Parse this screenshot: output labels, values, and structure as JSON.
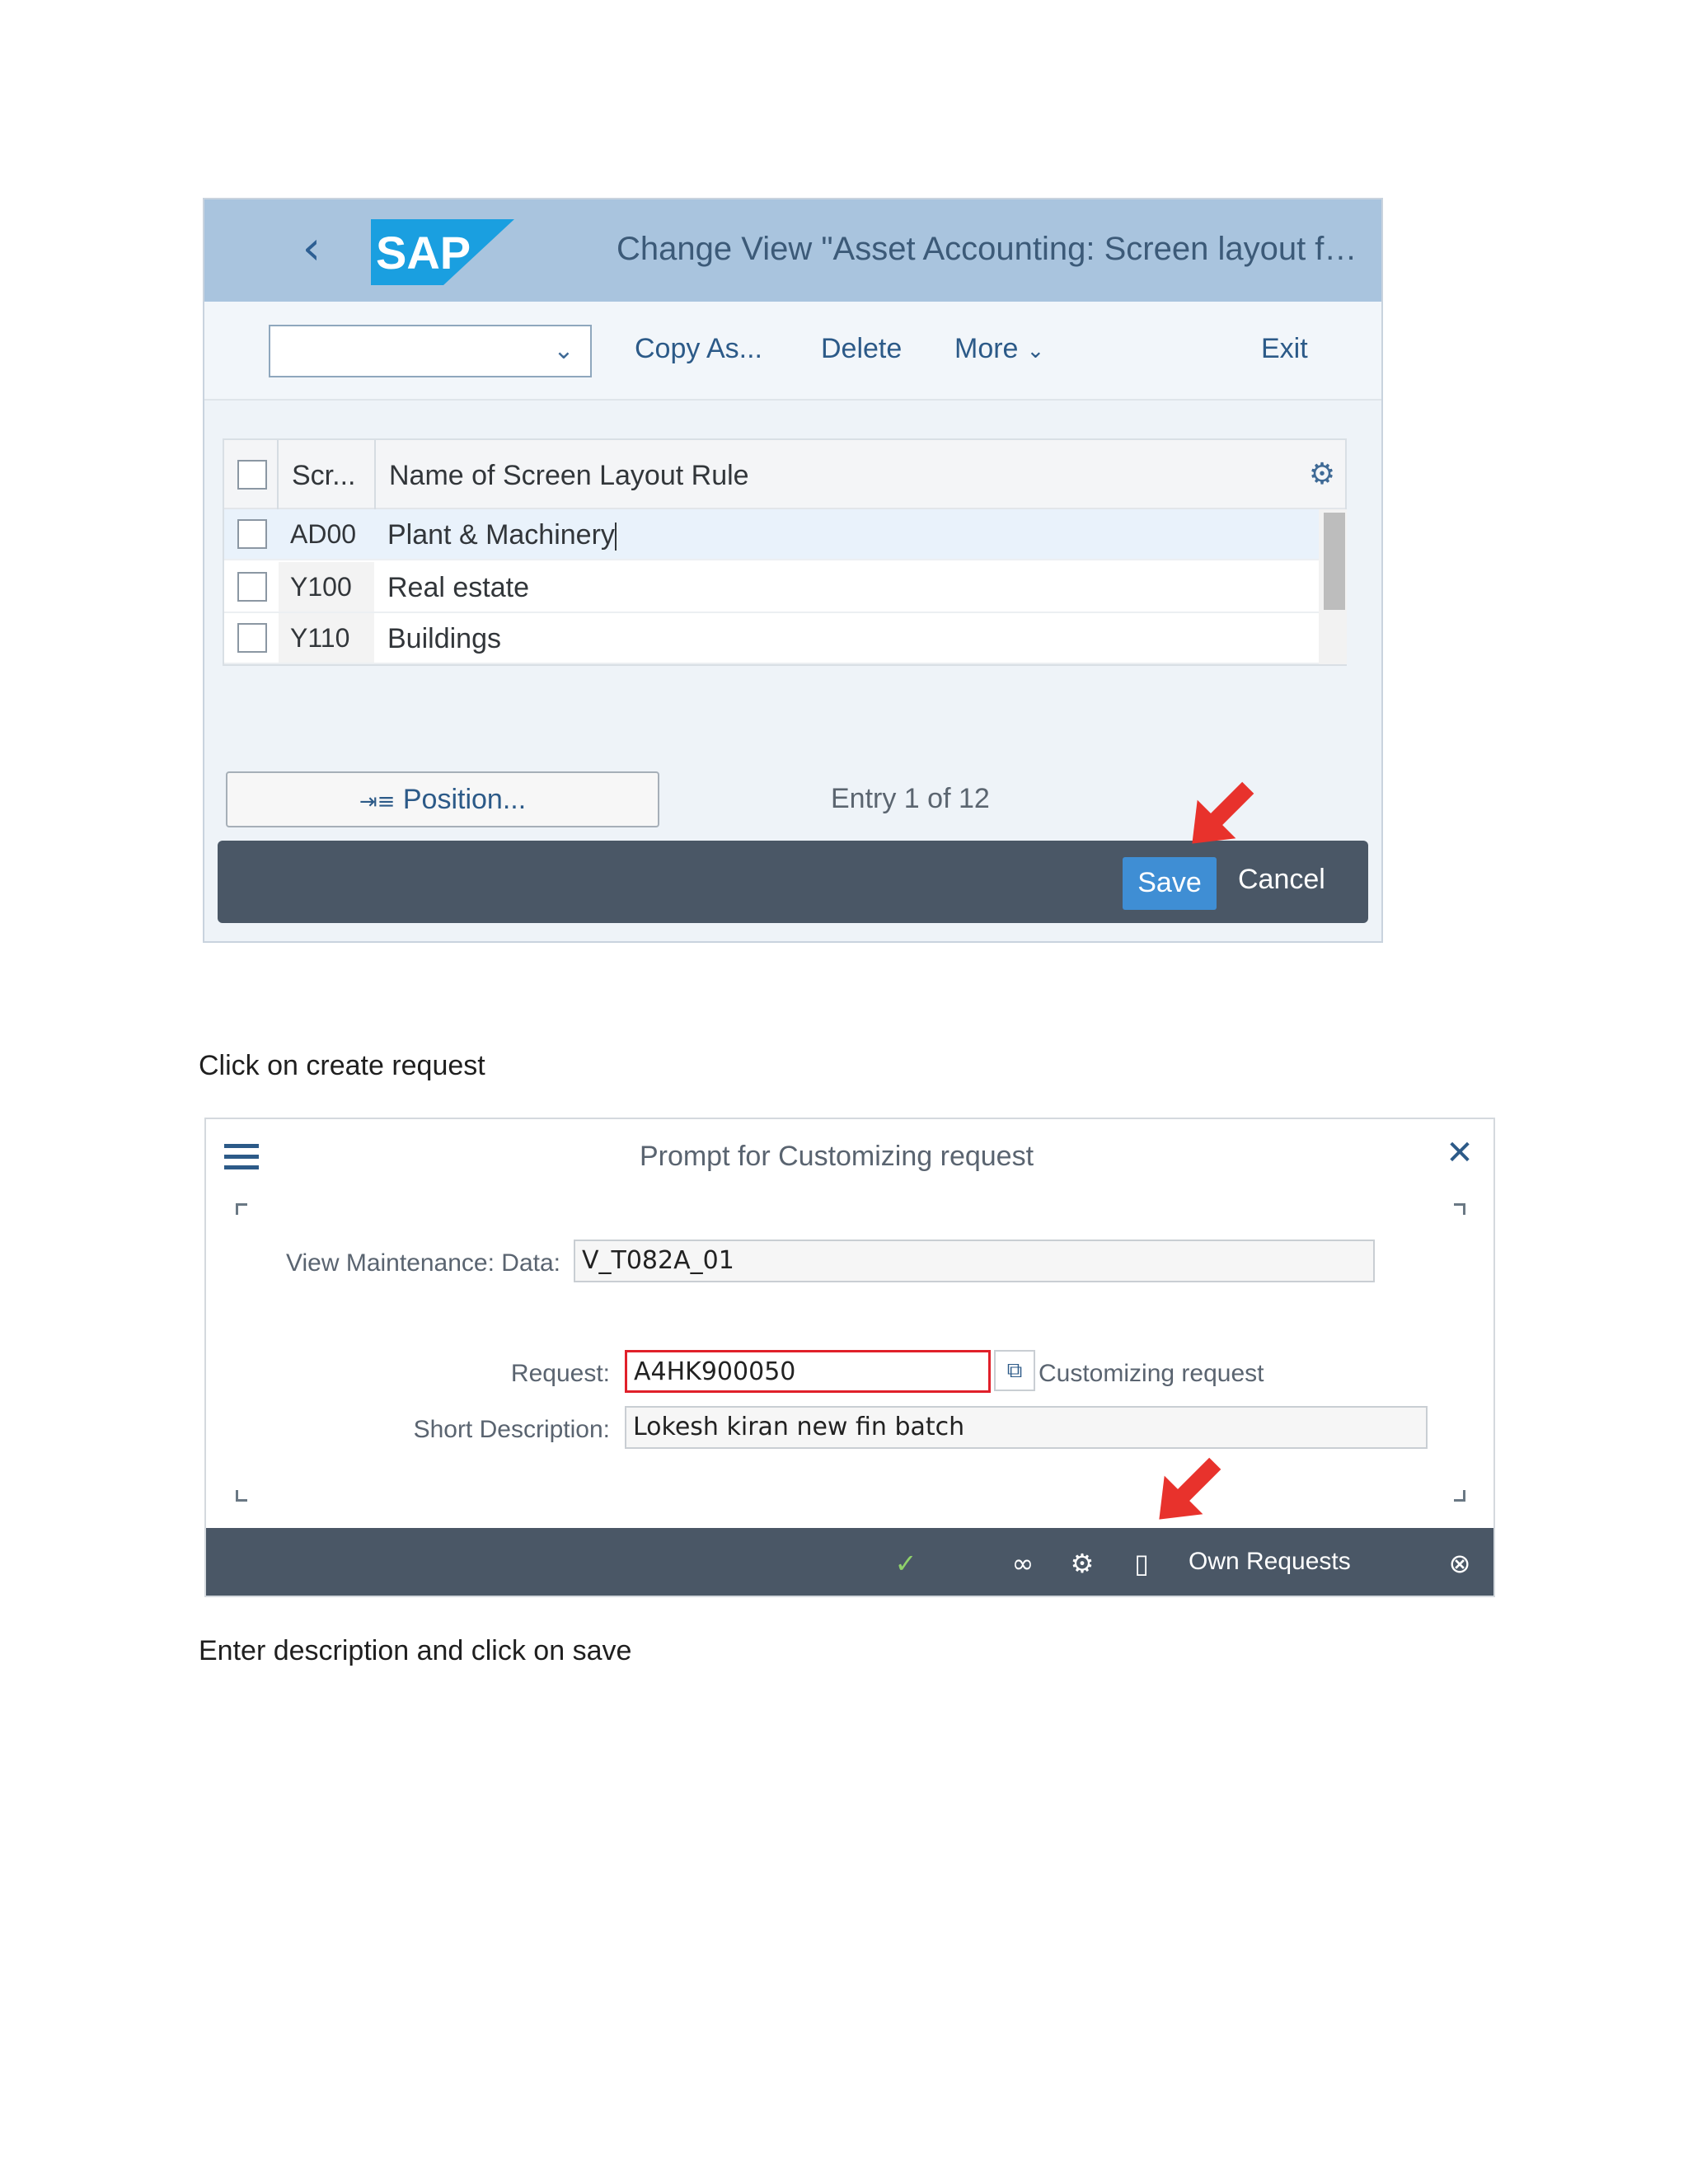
{
  "screen1": {
    "header": {
      "title": "Change View \"Asset Accounting: Screen layout for...",
      "logo_text": "SAP",
      "back_icon": "chevron-left-icon"
    },
    "toolbar": {
      "dropdown_value": "",
      "copy_as": "Copy As...",
      "delete": "Delete",
      "more": "More",
      "exit": "Exit"
    },
    "table": {
      "columns": [
        "Scr...",
        "Name of Screen Layout Rule"
      ],
      "rows": [
        {
          "key": "AD00",
          "name": "Plant & Machinery",
          "selected": true
        },
        {
          "key": "Y100",
          "name": "Real estate",
          "selected": false
        },
        {
          "key": "Y110",
          "name": "Buildings",
          "selected": false
        }
      ]
    },
    "position_button": "Position...",
    "entry_text": "Entry 1 of 12",
    "footer": {
      "save": "Save",
      "cancel": "Cancel"
    }
  },
  "caption1": "Click on create request",
  "screen2": {
    "title": "Prompt for Customizing request",
    "view_label": "View Maintenance: Data:",
    "view_value": "V_T082A_01",
    "request_label": "Request:",
    "request_value": "A4HK900050",
    "request_desc": "Customizing request",
    "short_desc_label": "Short Description:",
    "short_desc_value": "Lokesh kiran new fin batch",
    "footer": {
      "own_requests": "Own Requests"
    }
  },
  "caption2": "Enter description and click on save",
  "colors": {
    "sap_blue": "#1a9fe0",
    "header_bg": "#a9c4de",
    "footer_bg": "#4a5766",
    "save_blue": "#3f8ed4",
    "highlight_red": "#e0202a",
    "arrow_red": "#e8322c"
  }
}
